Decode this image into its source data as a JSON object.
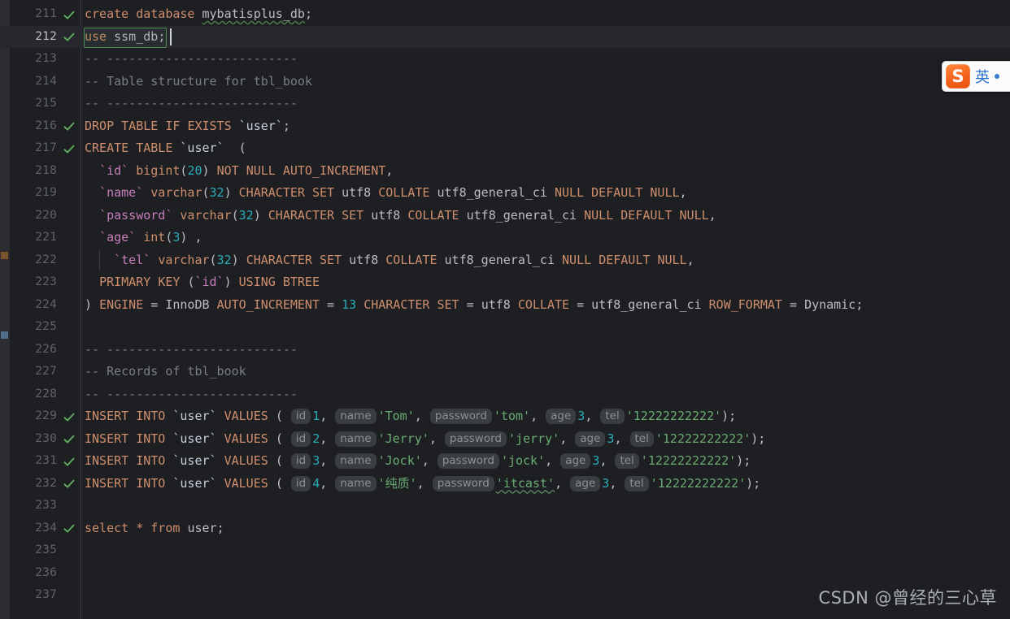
{
  "app": {
    "type": "code-editor",
    "language": "sql",
    "theme": "dark",
    "background": "#1e1f22",
    "gutter_background": "#1e1f22",
    "current_line_background": "#26282e"
  },
  "editor": {
    "first_visible_line": 211,
    "last_visible_line": 237,
    "caret_line": 212,
    "caret_column": 12,
    "selection_text": "use ssm_db"
  },
  "lines": [
    {
      "n": "211",
      "check": true,
      "current": false
    },
    {
      "n": "212",
      "check": true,
      "current": true
    },
    {
      "n": "213",
      "check": false,
      "current": false
    },
    {
      "n": "214",
      "check": false,
      "current": false
    },
    {
      "n": "215",
      "check": false,
      "current": false
    },
    {
      "n": "216",
      "check": true,
      "current": false
    },
    {
      "n": "217",
      "check": true,
      "current": false
    },
    {
      "n": "218",
      "check": false,
      "current": false
    },
    {
      "n": "219",
      "check": false,
      "current": false
    },
    {
      "n": "220",
      "check": false,
      "current": false
    },
    {
      "n": "221",
      "check": false,
      "current": false
    },
    {
      "n": "222",
      "check": false,
      "current": false
    },
    {
      "n": "223",
      "check": false,
      "current": false
    },
    {
      "n": "224",
      "check": false,
      "current": false
    },
    {
      "n": "225",
      "check": false,
      "current": false
    },
    {
      "n": "226",
      "check": false,
      "current": false
    },
    {
      "n": "227",
      "check": false,
      "current": false
    },
    {
      "n": "228",
      "check": false,
      "current": false
    },
    {
      "n": "229",
      "check": true,
      "current": false
    },
    {
      "n": "230",
      "check": true,
      "current": false
    },
    {
      "n": "231",
      "check": true,
      "current": false
    },
    {
      "n": "232",
      "check": true,
      "current": false
    },
    {
      "n": "233",
      "check": false,
      "current": false
    },
    {
      "n": "234",
      "check": true,
      "current": false
    },
    {
      "n": "235",
      "check": false,
      "current": false
    },
    {
      "n": "236",
      "check": false,
      "current": false
    },
    {
      "n": "237",
      "check": false,
      "current": false
    }
  ],
  "code_text": {
    "l211": "create database mybatisplus_db;",
    "l212": "use ssm_db;",
    "l213": "-- --------------------------",
    "l214": "-- Table structure for tbl_book",
    "l215": "-- --------------------------",
    "l216": "DROP TABLE IF EXISTS `user`;",
    "l217": "CREATE TABLE `user`  (",
    "l218": "  `id` bigint(20) NOT NULL AUTO_INCREMENT,",
    "l219": "  `name` varchar(32) CHARACTER SET utf8 COLLATE utf8_general_ci NULL DEFAULT NULL,",
    "l220": "  `password` varchar(32) CHARACTER SET utf8 COLLATE utf8_general_ci NULL DEFAULT NULL,",
    "l221": "  `age` int(3) ,",
    "l222": "    `tel` varchar(32) CHARACTER SET utf8 COLLATE utf8_general_ci NULL DEFAULT NULL,",
    "l223": "  PRIMARY KEY (`id`) USING BTREE",
    "l224": ") ENGINE = InnoDB AUTO_INCREMENT = 13 CHARACTER SET = utf8 COLLATE = utf8_general_ci ROW_FORMAT = Dynamic;",
    "l225": "",
    "l226": "-- --------------------------",
    "l227": "-- Records of tbl_book",
    "l228": "-- --------------------------",
    "l229": "INSERT INTO `user` VALUES (1, 'Tom', 'tom', 3, '12222222222');",
    "l230": "INSERT INTO `user` VALUES (2, 'Jerry', 'jerry', 3, '12222222222');",
    "l231": "INSERT INTO `user` VALUES (3, 'Jock', 'jock', 3, '12222222222');",
    "l232": "INSERT INTO `user` VALUES (4, '纯质', 'itcast', 3, '12222222222');",
    "l233": "",
    "l234": "select * from user;",
    "l235": "",
    "l236": "",
    "l237": ""
  },
  "tokens": {
    "create": "create",
    "database": "database",
    "mybatisplus_db": "mybatisplus_db",
    "use": "use",
    "ssm_db": "ssm_db",
    "semi": ";",
    "dashrule": "-- --------------------------",
    "table_structure_comment": "-- Table structure for tbl_book",
    "records_comment": "-- Records of tbl_book",
    "drop": "DROP",
    "table": "TABLE",
    "if": "IF",
    "exists": "EXISTS",
    "user_tick": "`user`",
    "create_u": "CREATE",
    "lparen": "(",
    "col_id": "`id`",
    "bigint": "bigint",
    "n20": "20",
    "not": "NOT",
    "null": "NULL",
    "auto_increment": "AUTO_INCREMENT",
    "col_name": "`name`",
    "varchar": "varchar",
    "n32": "32",
    "character": "CHARACTER",
    "set": "SET",
    "utf8": "utf8",
    "collate": "COLLATE",
    "utf8_general_ci": "utf8_general_ci",
    "default": "DEFAULT",
    "col_password": "`password`",
    "col_age": "`age`",
    "int": "int",
    "n3": "3",
    "col_tel": "`tel`",
    "primary": "PRIMARY",
    "key": "KEY",
    "using": "USING",
    "btree": "BTREE",
    "rparen": ")",
    "engine": "ENGINE",
    "eq": "=",
    "innodb": "InnoDB",
    "n13": "13",
    "row_format": "ROW_FORMAT",
    "dynamic": "Dynamic",
    "insert": "INSERT",
    "into": "INTO",
    "values": "VALUES",
    "select": "select",
    "star": "*",
    "from": "from",
    "user_plain": "user"
  },
  "inlay_hints": {
    "id": "id",
    "name": "name",
    "password": "password",
    "age": "age",
    "tel": "tel"
  },
  "rows_data": [
    {
      "id": "1",
      "name": "'Tom'",
      "password": "'tom'",
      "age": "3",
      "tel": "'12222222222'"
    },
    {
      "id": "2",
      "name": "'Jerry'",
      "password": "'jerry'",
      "age": "3",
      "tel": "'12222222222'"
    },
    {
      "id": "3",
      "name": "'Jock'",
      "password": "'jock'",
      "age": "3",
      "tel": "'12222222222'"
    },
    {
      "id": "4",
      "name": "'纯质'",
      "password": "'itcast'",
      "age": "3",
      "tel": "'12222222222'"
    }
  ],
  "ime": {
    "logo_letter": "S",
    "mode_label": "英",
    "name": "sogou-input-method"
  },
  "watermark": {
    "text": "CSDN @曾经的三心草"
  },
  "colors": {
    "keyword": "#cf8e6d",
    "string": "#6aab73",
    "number": "#2aacb8",
    "comment": "#7a7e85",
    "column": "#c77dbb",
    "identifier": "#bcbec4",
    "inlay_chip_bg": "#3a3d41",
    "inlay_chip_fg": "#8c9196",
    "check_green": "#5fad5f",
    "selection_border": "#4f8a52",
    "ime_orange": "#f4621a",
    "ime_blue": "#2f6fd0"
  }
}
